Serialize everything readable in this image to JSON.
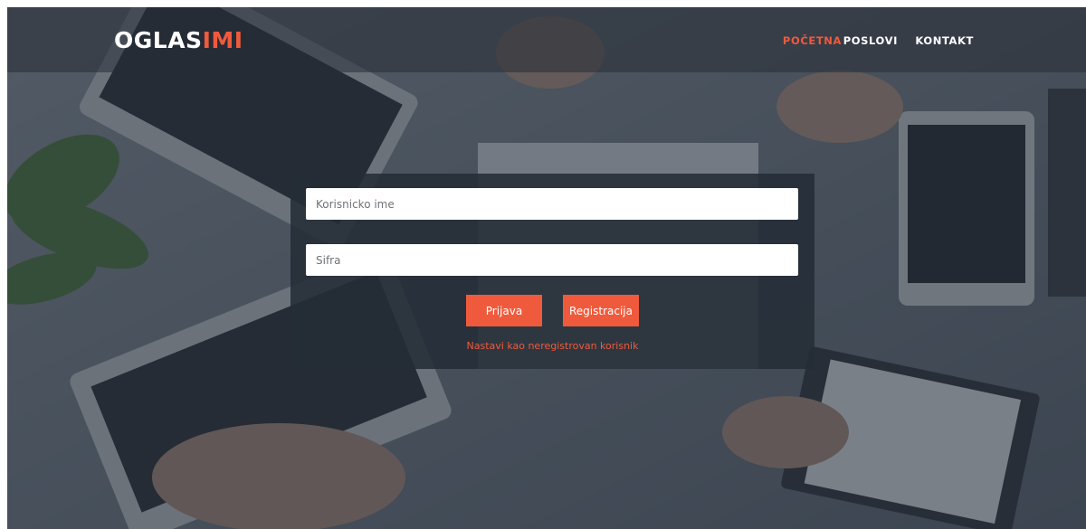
{
  "brand": {
    "logo_part1": "OGLAS",
    "logo_part2": "IMI",
    "accent_color": "#f05a3c"
  },
  "nav": {
    "items": [
      {
        "label": "POČETNA",
        "active": true
      },
      {
        "label": "POSLOVI",
        "active": false
      },
      {
        "label": "KONTAKT",
        "active": false
      }
    ]
  },
  "login_form": {
    "username_placeholder": "Korisnicko ime",
    "username_value": "",
    "password_placeholder": "Sifra",
    "password_value": "",
    "login_button": "Prijava",
    "register_button": "Registracija",
    "guest_link": "Nastavi kao neregistrovan korisnik"
  },
  "colors": {
    "button_bg": "#f05a3c",
    "panel_bg": "#242c37",
    "overlay": "#202a36"
  }
}
